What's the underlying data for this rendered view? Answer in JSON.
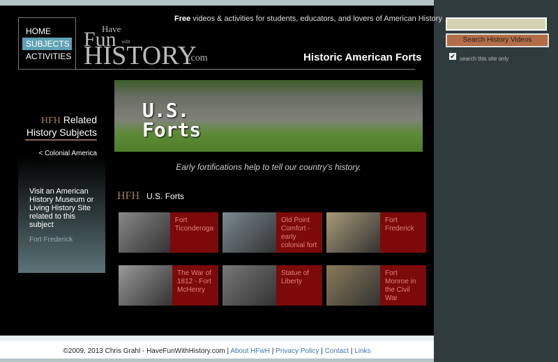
{
  "nav": [
    "HOME",
    "SUBJECTS",
    "ACTIVITIES"
  ],
  "logo": {
    "have": "Have",
    "fun": "Fun",
    "with": "with",
    "history": "HISTORY",
    ".com": ".com"
  },
  "tagline": {
    "bold": "Free",
    "rest": " videos & activities for students, educators, and lovers of American History"
  },
  "page_title": "Historic American Forts",
  "sidebar": {
    "heading_mark": "HFH",
    "heading": "Related History Subjects",
    "back_arrow": "< ",
    "colonial": "Colonial America",
    "visit": "Visit an American History Museum or Living History Site related to this subject",
    "fort": "Fort Frederick"
  },
  "banner": {
    "text": "U.S. Forts"
  },
  "caption": "Early fortifications help to tell our country's history.",
  "section": {
    "mark": "HFH",
    "title": "U.S. Forts"
  },
  "cards": [
    {
      "label": "Fort Ticonderoga",
      "color": "#888"
    },
    {
      "label": "Old Point Comfort - early colonial fort",
      "color": "#7a8a90"
    },
    {
      "label": "Fort Frederick",
      "color": "#a89a78"
    },
    {
      "label": "The War of 1812 - Fort McHenry",
      "color": "#999"
    },
    {
      "label": "Statue of Liberty",
      "color": "#777"
    },
    {
      "label": "Fort Monroe in the Civil War",
      "color": "#8a7a5a"
    }
  ],
  "search": {
    "value": "",
    "button": "Search History Videos",
    "check_label": "search this site only",
    "checked": true
  },
  "footer": {
    "copy": "©2009, 2013 Chris Grahl - HaveFunWithHistory.com | ",
    "about": "About HFwH",
    "privacy": "Privacy Policy",
    "contact": "Contact",
    "links": "Links",
    "sep": " | "
  }
}
